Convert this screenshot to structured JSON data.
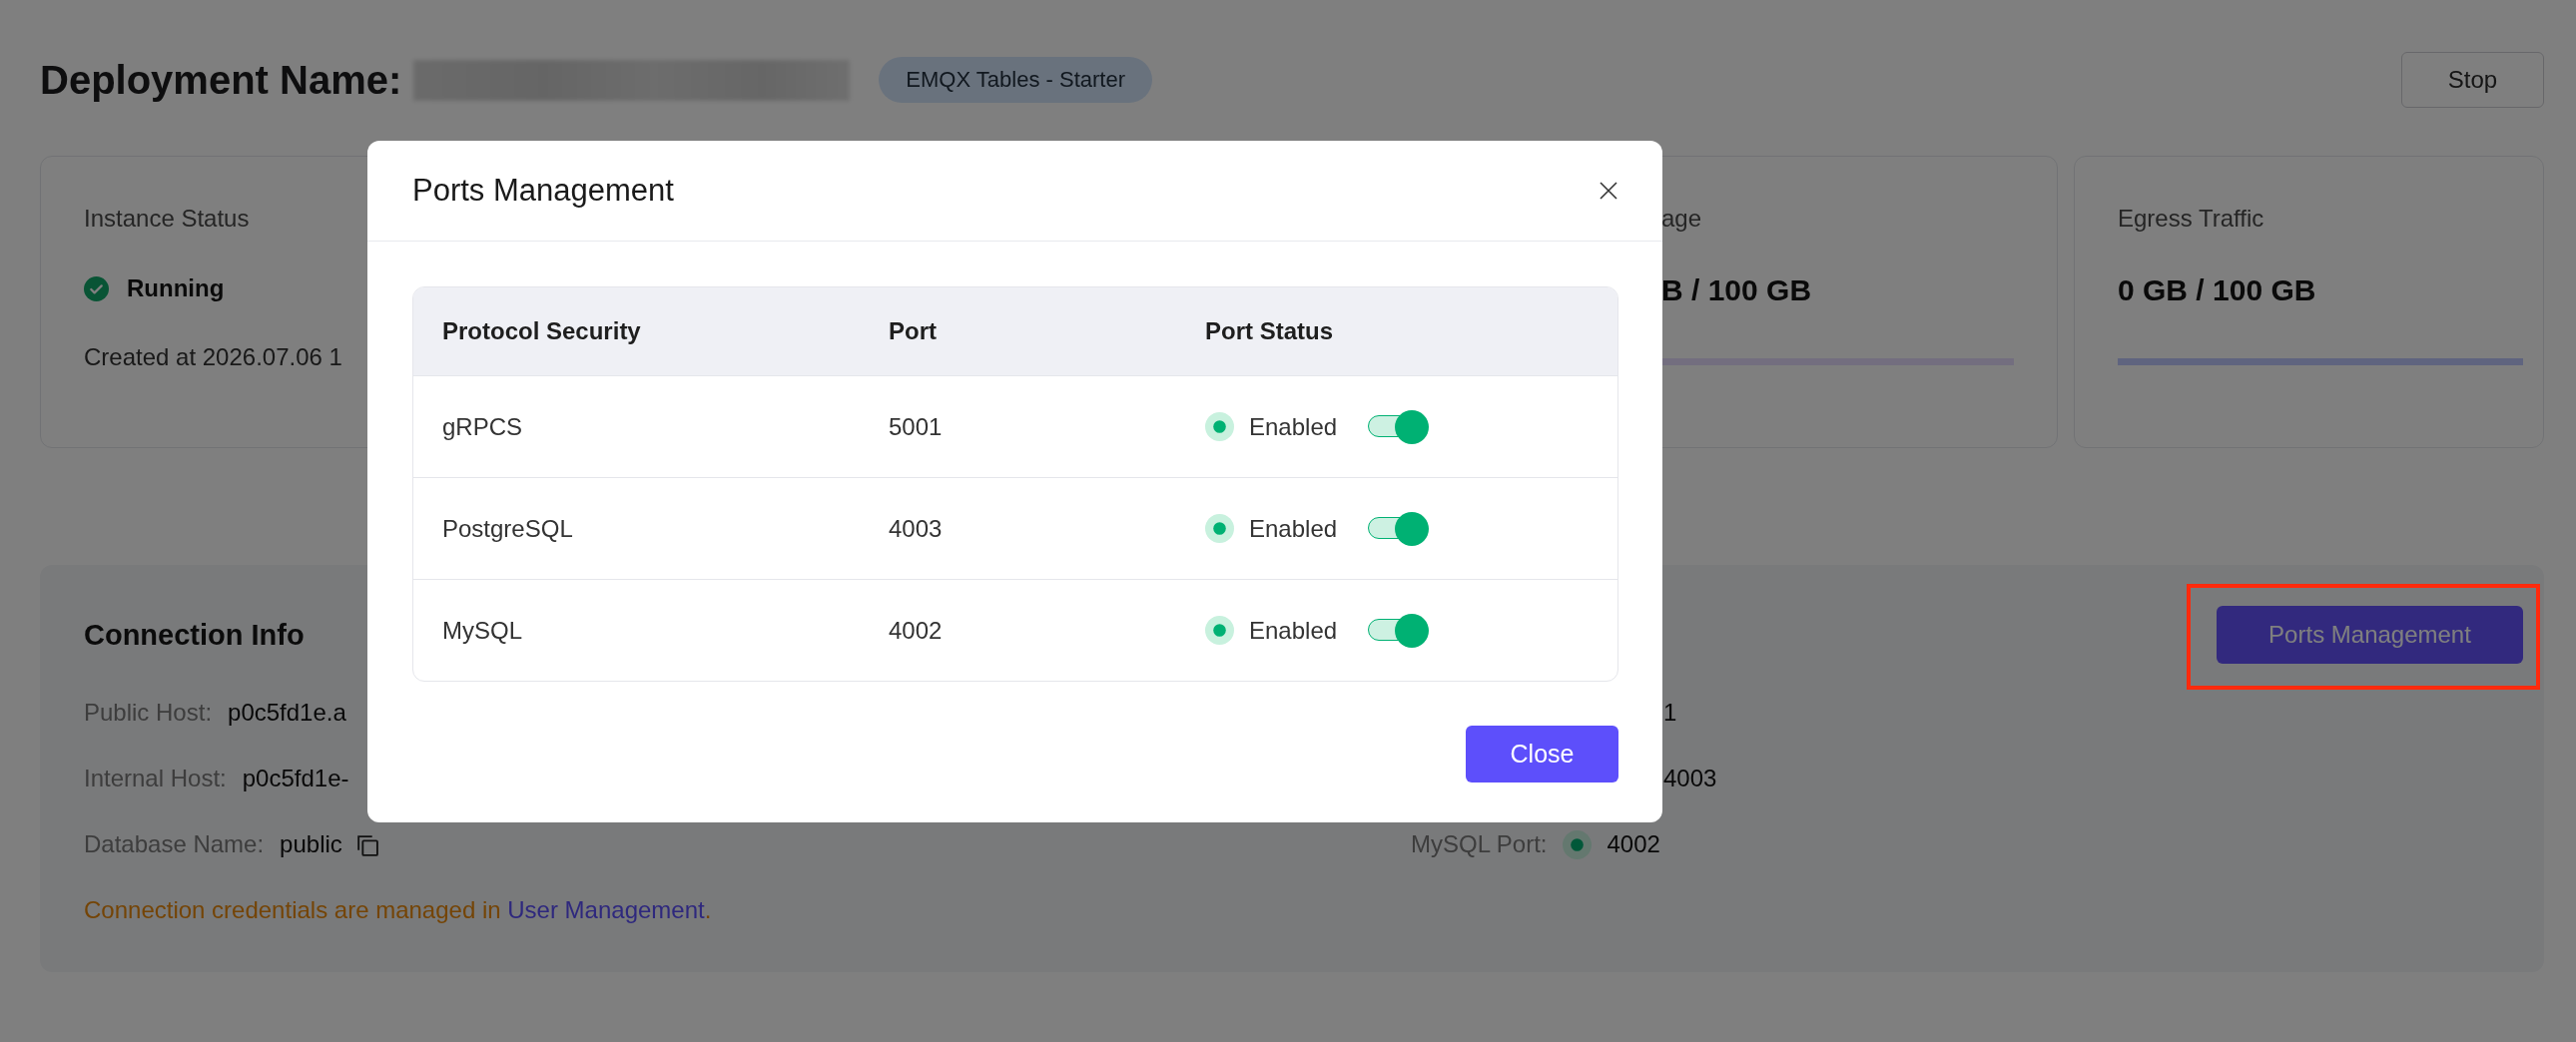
{
  "header": {
    "title": "Deployment Name:",
    "plan_badge": "EMQX Tables - Starter",
    "stop_button": "Stop"
  },
  "cards": [
    {
      "kind": "status",
      "label": "Instance Status",
      "status": {
        "text": "Running",
        "ok": true
      },
      "created": "Created at 2026.07.06 1"
    },
    {
      "kind": "usage",
      "label": "age",
      "value": "B / 100 GB"
    },
    {
      "kind": "usage",
      "label": "Egress Traffic",
      "value": "0 GB / 100 GB"
    }
  ],
  "connection": {
    "title": "Connection Info",
    "ports_button": "Ports Management",
    "fields": [
      {
        "label": "Public Host:",
        "value": "p0c5fd1e.a",
        "copyable": false
      },
      {
        "label": "Internal Host:",
        "value": "p0c5fd1e-",
        "copyable": false
      },
      {
        "label": "Database Name:",
        "value": "public",
        "copyable": true
      }
    ],
    "ports": [
      {
        "kind": "fragment",
        "value": "1"
      },
      {
        "kind": "fragment",
        "value": "4003"
      },
      {
        "kind": "full",
        "label": "MySQL Port:",
        "value": "4002",
        "on": true
      }
    ],
    "note": {
      "text": "Connection credentials are managed in ",
      "link": "User Management",
      "after": "."
    }
  },
  "modal": {
    "title": "Ports Management",
    "columns": [
      "Protocol Security",
      "Port",
      "Port Status"
    ],
    "rows": [
      {
        "protocol": "gRPCS",
        "port": "5001",
        "status": "Enabled",
        "on": true
      },
      {
        "protocol": "PostgreSQL",
        "port": "4003",
        "status": "Enabled",
        "on": true
      },
      {
        "protocol": "MySQL",
        "port": "4002",
        "status": "Enabled",
        "on": true
      }
    ],
    "close_button": "Close"
  }
}
